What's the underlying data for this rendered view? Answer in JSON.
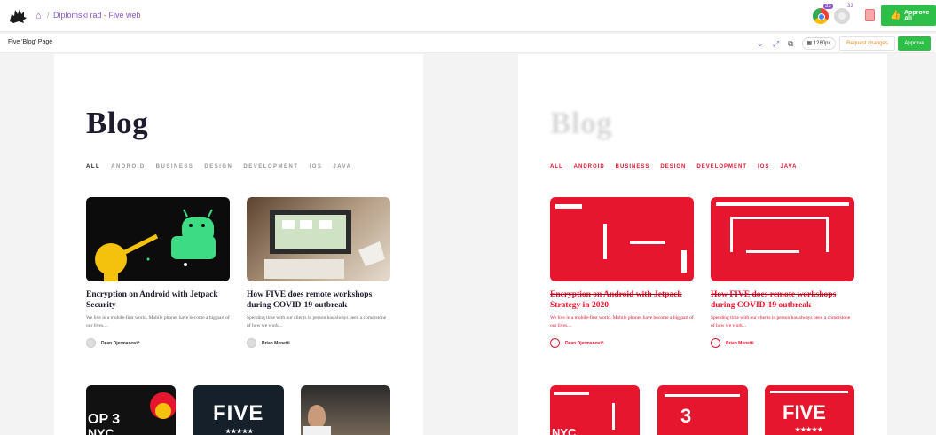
{
  "header": {
    "breadcrumb_separator": "/",
    "project": "Diplomski rad - Five web",
    "avatar_badges": [
      "33",
      "33"
    ],
    "approve_all_label": "Approve All"
  },
  "toolbar": {
    "page_label": "Five 'Blog' Page",
    "width_label": "1280px",
    "request_changes_label": "Request changes",
    "approve_label": "Approve"
  },
  "blog": {
    "title": "Blog",
    "categories": [
      "ALL",
      "ANDROID",
      "BUSINESS",
      "DESIGN",
      "DEVELOPMENT",
      "IOS",
      "JAVA"
    ],
    "posts": [
      {
        "title": "Encryption on Android with Jetpack Security",
        "excerpt": "We live in a mobile-first world. Mobile phones have become a big part of our lives....",
        "author": "Dean Djermanović"
      },
      {
        "title": "How FIVE does remote workshops during COVID-19 outbreak",
        "excerpt": "Spending time with our clients in person has always been a cornerstone of how we work...",
        "author": "Brian Menetti"
      }
    ],
    "row2_texts": [
      "OP 3",
      "NYC",
      "FIVE",
      "★★★★★"
    ]
  },
  "compare": {
    "posts": [
      {
        "title": "Encryption on Android with Jetpack Strategy in 2020",
        "excerpt": "We live in a mobile-first world. Mobile phones have become a big part of our lives....",
        "author": "Dean Djermanović"
      },
      {
        "title": "How FIVE does remote workshops during COVID-19 outbreak",
        "excerpt": "Spending time with our clients in person has always been a cornerstone of how we work...",
        "author": "Brian Menetti"
      }
    ],
    "row2_texts": [
      "3",
      "NYC",
      "FIVE",
      "★★★★★"
    ]
  },
  "colors": {
    "brand_purple": "#8a56c8",
    "approve_green": "#2dbf47",
    "request_orange": "#f08a2a",
    "diff_red": "#e6162f"
  }
}
